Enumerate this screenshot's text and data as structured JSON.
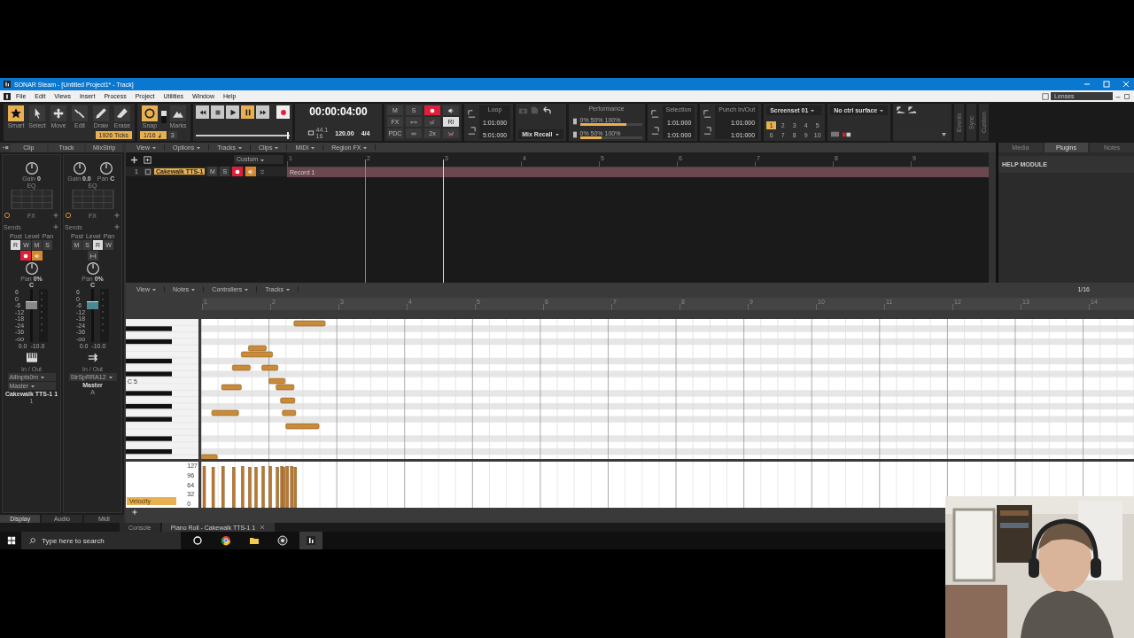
{
  "window": {
    "title": "SONAR Steam - [Untitled Project1* - Track]"
  },
  "menu": [
    "File",
    "Edit",
    "Views",
    "Insert",
    "Process",
    "Project",
    "Utilities",
    "Window",
    "Help"
  ],
  "lenses": "Lenses",
  "tools": [
    {
      "label": "Smart",
      "kind": "star",
      "selected": true
    },
    {
      "label": "Select",
      "kind": "pointer",
      "selected": false
    },
    {
      "label": "Move",
      "kind": "move",
      "selected": false
    },
    {
      "label": "Edit",
      "kind": "wrench",
      "selected": false
    },
    {
      "label": "Draw",
      "kind": "pencil",
      "selected": false
    },
    {
      "label": "Erase",
      "kind": "eraser",
      "selected": false
    }
  ],
  "ticks": "1926 Ticks",
  "snap": {
    "label": "Snap",
    "on": true,
    "value": "1/16",
    "triplet": "3",
    "marks": "Marks"
  },
  "transport": {
    "buttons": [
      {
        "kind": "rewind",
        "on": false
      },
      {
        "kind": "stop",
        "on": false
      },
      {
        "kind": "play",
        "on": false
      },
      {
        "kind": "pause",
        "on": true
      },
      {
        "kind": "forward",
        "on": false
      },
      {
        "kind": "record",
        "on": false
      }
    ],
    "scrub": {
      "level": 0.97
    }
  },
  "time": {
    "display": "00:00:04:00",
    "sample_rate": "44.1",
    "bit_depth": "16",
    "tempo": "120.00",
    "meter": "4/4"
  },
  "mix": [
    {
      "kind": "text",
      "label": "M",
      "on": false
    },
    {
      "kind": "text",
      "label": "S",
      "on": false
    },
    {
      "kind": "record",
      "on": true
    },
    {
      "kind": "speaker",
      "on": false
    },
    {
      "kind": "text",
      "label": "FX",
      "on": false
    },
    {
      "kind": "link",
      "on": false
    },
    {
      "kind": "wave",
      "on": false
    },
    {
      "kind": "text",
      "label": "RI",
      "on": true
    },
    {
      "kind": "text",
      "label": "PDC",
      "on": false
    },
    {
      "kind": "dim",
      "on": false
    },
    {
      "kind": "text",
      "label": "2x",
      "on": false
    },
    {
      "kind": "cross",
      "on": false
    }
  ],
  "loop": {
    "title": "Loop",
    "start": "1:01:000",
    "end": "5:01:000"
  },
  "mix_recall": "Mix Recall",
  "performance": {
    "title": "Performance",
    "meters": [
      {
        "scale": "0%  50%  100%",
        "level": 0.75
      },
      {
        "scale": "0%  50%  100%",
        "level": 0.35
      }
    ]
  },
  "selection": {
    "title": "Selection",
    "start": "1:01:000",
    "end": "1:01:000"
  },
  "punch": {
    "title": "Punch In/Out",
    "start": "1:01:000",
    "end": "1:01:000"
  },
  "screenset": {
    "title": "Screenset 01",
    "slots": [
      {
        "label": "1",
        "selected": true
      },
      {
        "label": "2",
        "selected": false
      },
      {
        "label": "3",
        "selected": false
      },
      {
        "label": "4",
        "selected": false
      },
      {
        "label": "5",
        "selected": false
      },
      {
        "label": "6",
        "selected": false
      },
      {
        "label": "7",
        "selected": false
      },
      {
        "label": "8",
        "selected": false
      },
      {
        "label": "9",
        "selected": false
      },
      {
        "label": "10",
        "selected": false
      }
    ]
  },
  "ctrl_surface": "No ctrl surface",
  "side_tabs": [
    "Events",
    "Sync",
    "Custom"
  ],
  "inspector": {
    "tabs": [
      "Clip",
      "Track",
      "MixStrip"
    ],
    "strips": [
      {
        "knobs": [
          {
            "label": "Gain",
            "value": "0"
          }
        ],
        "eq": "EQ",
        "fx": "FX",
        "sends": "Sends",
        "send_knobs": [
          "Post",
          "Level",
          "Pan"
        ],
        "buttons": [
          {
            "kind": "text",
            "label": "R",
            "on": true
          },
          {
            "kind": "text",
            "label": "W",
            "on": false
          },
          {
            "kind": "text",
            "label": "M",
            "on": false
          },
          {
            "kind": "text",
            "label": "S",
            "on": false
          },
          {
            "kind": "record",
            "on": true
          },
          {
            "kind": "monitor",
            "on": true
          }
        ],
        "pan": {
          "label": "Pan",
          "value": "0% C"
        },
        "scale": [
          "6",
          "0",
          "-6",
          "-12",
          "-18",
          "-24",
          "-36",
          "-oo"
        ],
        "fader": {
          "level": 0.72
        },
        "readouts": [
          "0.0",
          "-10.0"
        ],
        "kind": "instrument",
        "io_label": "In / Out",
        "io": [
          "AllInpts0m",
          "Master"
        ],
        "name": "Cakewalk TTS-1 1",
        "sub": "1"
      },
      {
        "knobs": [
          {
            "label": "Gain",
            "value": "0.0"
          },
          {
            "label": "Pan",
            "value": "C"
          }
        ],
        "eq": "EQ",
        "fx": "FX",
        "sends": "Sends",
        "send_knobs": [
          "Post",
          "Level",
          "Pan"
        ],
        "buttons": [
          {
            "kind": "text",
            "label": "M",
            "on": false
          },
          {
            "kind": "text",
            "label": "S",
            "on": false
          },
          {
            "kind": "text",
            "label": "R",
            "on": true
          },
          {
            "kind": "text",
            "label": "W",
            "on": false
          },
          {
            "kind": "width",
            "on": false
          }
        ],
        "pan": {
          "label": "Pan",
          "value": "0% C"
        },
        "scale": [
          "6",
          "0",
          "-6",
          "-12",
          "-18",
          "-24",
          "-36",
          "-oo"
        ],
        "fader": {
          "level": 0.72
        },
        "readouts": [
          "0.0",
          "-10.0"
        ],
        "kind": "bus",
        "io_label": "In / Out",
        "io": [
          "StrSpRRA12"
        ],
        "name": "Master",
        "sub": "A"
      }
    ],
    "bottom_tabs": [
      {
        "label": "Display",
        "selected": true
      },
      {
        "label": "Audio",
        "selected": false
      },
      {
        "label": "Midi",
        "selected": false
      }
    ]
  },
  "track_view": {
    "menus": [
      "View",
      "Options",
      "Tracks",
      "Clips",
      "MIDI",
      "Region FX"
    ],
    "preset": "Custom",
    "ruler": [
      "1",
      "2",
      "3",
      "4",
      "5",
      "6",
      "7",
      "8",
      "9"
    ],
    "tracks": [
      {
        "number": "1",
        "name": "Cakewalk TTS-1",
        "mute_label": "M",
        "mute": false,
        "solo_label": "S",
        "solo": false,
        "armed": true,
        "monitor": true,
        "clip": "Record 1"
      }
    ]
  },
  "browser": {
    "tabs": [
      {
        "label": "Media",
        "selected": false
      },
      {
        "label": "Plugins",
        "selected": true
      },
      {
        "label": "Notes",
        "selected": false
      }
    ],
    "help": "HELP MODULE"
  },
  "piano_roll": {
    "menus": [
      "View",
      "Notes",
      "Controllers",
      "Tracks"
    ],
    "snap": "1/16",
    "ruler": [
      "1",
      "2",
      "3",
      "4",
      "5",
      "6",
      "7",
      "8",
      "9",
      "10",
      "11",
      "12",
      "13",
      "14"
    ],
    "key_label": "C 5",
    "velocity_scale": [
      "127",
      "96",
      "64",
      "32",
      "0"
    ],
    "controller": "Velocity"
  },
  "dock_tabs": [
    {
      "label": "Console",
      "selected": false,
      "closable": false
    },
    {
      "label": "Piano Roll - Cakewalk TTS-1 1",
      "selected": true,
      "closable": true
    }
  ],
  "taskbar": {
    "search": "Type here to search",
    "apps": [
      {
        "kind": "ring",
        "selected": false
      },
      {
        "kind": "browser",
        "selected": false
      },
      {
        "kind": "folder",
        "selected": false
      },
      {
        "kind": "aperture",
        "selected": false
      },
      {
        "kind": "daw",
        "selected": true
      }
    ]
  },
  "webcam": {
    "kind": "picture"
  }
}
